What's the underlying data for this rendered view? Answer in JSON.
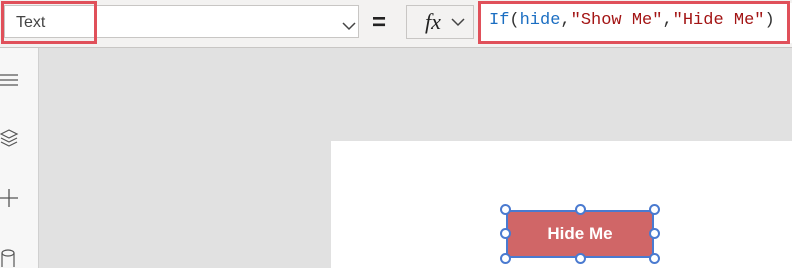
{
  "formula_bar": {
    "property": "Text",
    "equals": "=",
    "fx_label": "fx",
    "formula": {
      "fn": "If",
      "open": "(",
      "arg1": "hide",
      "sep1": ",",
      "arg2": "\"Show Me\"",
      "sep2": ",",
      "arg3": "\"Hide Me\"",
      "close": ")"
    }
  },
  "canvas": {
    "button_label": "Hide Me"
  },
  "colors": {
    "highlight": "#e0505a",
    "button_fill": "#d06667",
    "selection": "#4a7ad0"
  },
  "icons": [
    "hamburger-menu-icon",
    "layers-icon",
    "plus-icon",
    "database-icon",
    "chevron-down-icon"
  ]
}
